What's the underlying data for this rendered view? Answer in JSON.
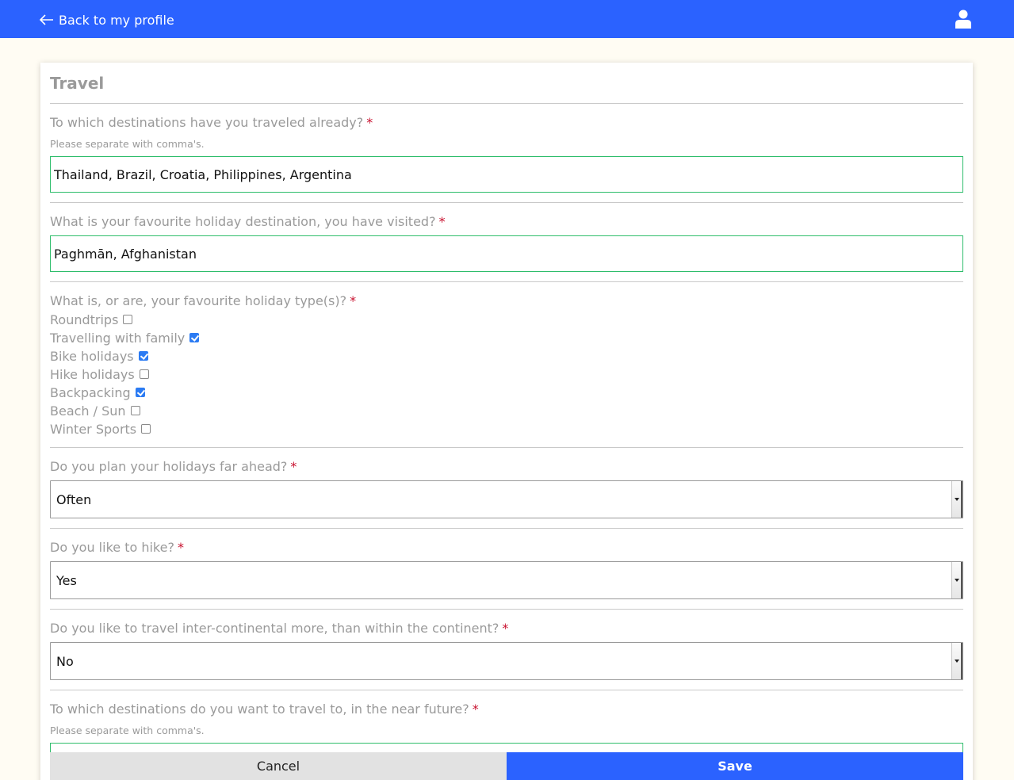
{
  "header": {
    "back_label": "Back to my profile",
    "back_icon": "arrow-left-icon",
    "user_icon": "user-icon",
    "color": "#2b62ff"
  },
  "card": {
    "title": "Travel"
  },
  "questions": {
    "q1": {
      "label": "To which destinations have you traveled already?",
      "required": "*",
      "hint": "Please separate with comma's.",
      "value": "Thailand, Brazil, Croatia, Philippines, Argentina"
    },
    "q2": {
      "label": "What is your favourite holiday destination, you have visited?",
      "required": "*",
      "value": "Paghmān, Afghanistan"
    },
    "q3": {
      "label": "What is, or are, your favourite holiday type(s)?",
      "required": "*",
      "options": [
        {
          "label": "Roundtrips",
          "checked": false
        },
        {
          "label": "Travelling with family",
          "checked": true
        },
        {
          "label": "Bike holidays",
          "checked": true
        },
        {
          "label": "Hike holidays",
          "checked": false
        },
        {
          "label": "Backpacking",
          "checked": true
        },
        {
          "label": "Beach / Sun",
          "checked": false
        },
        {
          "label": "Winter Sports",
          "checked": false
        }
      ]
    },
    "q4": {
      "label": "Do you plan your holidays far ahead?",
      "required": "*",
      "value": "Often"
    },
    "q5": {
      "label": "Do you like to hike?",
      "required": "*",
      "value": "Yes"
    },
    "q6": {
      "label": "Do you like to travel inter-continental more, than within the continent?",
      "required": "*",
      "value": "No"
    },
    "q7": {
      "label": "To which destinations do you want to travel to, in the near future?",
      "required": "*",
      "hint": "Please separate with comma's.",
      "value": ""
    }
  },
  "footer": {
    "cancel_label": "Cancel",
    "save_label": "Save"
  }
}
